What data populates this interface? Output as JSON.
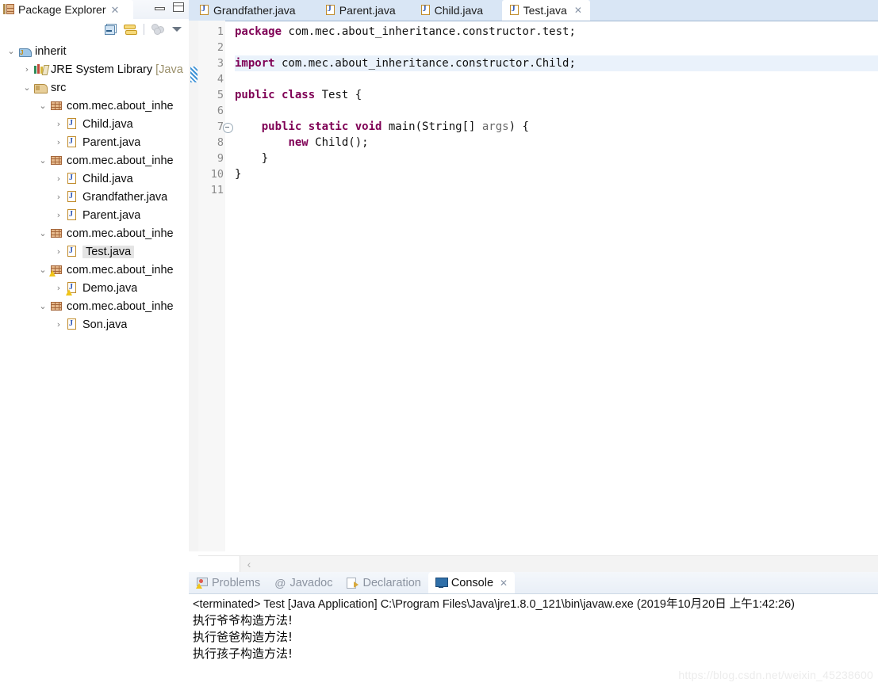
{
  "explorer": {
    "title": "Package Explorer",
    "close_icon": "✕",
    "minimize_tooltip": "Minimize",
    "maximize_tooltip": "Maximize",
    "toolbar": {
      "collapse_all": "collapse-all-icon",
      "link_with_editor": "link-with-editor-icon",
      "hierarchy": "hierarchy-icon",
      "view_menu": "view-menu-icon"
    },
    "tree": [
      {
        "label": "inherit",
        "icon": "java-project-icon",
        "arrow": "⌄",
        "indent": 0,
        "type": "project",
        "selected": false
      },
      {
        "label": "JRE System Library [Java",
        "icon": "jre-library-icon",
        "arrow": "›",
        "indent": 1,
        "type": "library",
        "selected": false
      },
      {
        "label": "src",
        "icon": "source-folder-icon",
        "arrow": "⌄",
        "indent": 1,
        "type": "source-folder",
        "selected": false
      },
      {
        "label": "com.mec.about_inhe",
        "icon": "package-icon",
        "arrow": "⌄",
        "indent": 2,
        "type": "package",
        "selected": false
      },
      {
        "label": "Child.java",
        "icon": "java-file-icon",
        "arrow": "›",
        "indent": 3,
        "type": "file",
        "selected": false
      },
      {
        "label": "Parent.java",
        "icon": "java-file-icon",
        "arrow": "›",
        "indent": 3,
        "type": "file",
        "selected": false
      },
      {
        "label": "com.mec.about_inhe",
        "icon": "package-icon",
        "arrow": "⌄",
        "indent": 2,
        "type": "package",
        "selected": false
      },
      {
        "label": "Child.java",
        "icon": "java-file-icon",
        "arrow": "›",
        "indent": 3,
        "type": "file",
        "selected": false
      },
      {
        "label": "Grandfather.java",
        "icon": "java-file-icon",
        "arrow": "›",
        "indent": 3,
        "type": "file",
        "selected": false
      },
      {
        "label": "Parent.java",
        "icon": "java-file-icon",
        "arrow": "›",
        "indent": 3,
        "type": "file",
        "selected": false
      },
      {
        "label": "com.mec.about_inhe",
        "icon": "package-icon",
        "arrow": "⌄",
        "indent": 2,
        "type": "package",
        "selected": false
      },
      {
        "label": "Test.java",
        "icon": "java-file-icon",
        "arrow": "›",
        "indent": 3,
        "type": "file",
        "selected": true
      },
      {
        "label": "com.mec.about_inhe",
        "icon": "package-warning-icon",
        "arrow": "⌄",
        "indent": 2,
        "type": "package",
        "selected": false,
        "warning": true
      },
      {
        "label": "Demo.java",
        "icon": "java-file-warning-icon",
        "arrow": "›",
        "indent": 3,
        "type": "file",
        "selected": false,
        "warning": true
      },
      {
        "label": "com.mec.about_inhe",
        "icon": "package-icon",
        "arrow": "⌄",
        "indent": 2,
        "type": "package",
        "selected": false
      },
      {
        "label": "Son.java",
        "icon": "java-file-icon",
        "arrow": "›",
        "indent": 3,
        "type": "file",
        "selected": false
      }
    ]
  },
  "editor": {
    "tabs": [
      {
        "label": "Grandfather.java",
        "active": false,
        "closable": false
      },
      {
        "label": "Parent.java",
        "active": false,
        "closable": false
      },
      {
        "label": "Child.java",
        "active": false,
        "closable": false
      },
      {
        "label": "Test.java",
        "active": true,
        "closable": true
      }
    ],
    "close_icon": "✕",
    "scroll_left_arrow": "‹",
    "highlighted_line": 3,
    "fold_marker_line": 7,
    "line_numbers": [
      "1",
      "2",
      "3",
      "4",
      "5",
      "6",
      "7",
      "8",
      "9",
      "10",
      "11"
    ],
    "code_lines": [
      {
        "n": 1,
        "segments": [
          {
            "t": "package",
            "c": "kw"
          },
          {
            "t": " com.mec.about_inheritance.constructor.test;",
            "c": ""
          }
        ]
      },
      {
        "n": 2,
        "segments": [
          {
            "t": "",
            "c": ""
          }
        ]
      },
      {
        "n": 3,
        "segments": [
          {
            "t": "import",
            "c": "kw"
          },
          {
            "t": " com.mec.about_inheritance.constructor.Child;",
            "c": ""
          }
        ]
      },
      {
        "n": 4,
        "segments": [
          {
            "t": "",
            "c": ""
          }
        ]
      },
      {
        "n": 5,
        "segments": [
          {
            "t": "public class",
            "c": "kw"
          },
          {
            "t": " Test {",
            "c": ""
          }
        ]
      },
      {
        "n": 6,
        "segments": [
          {
            "t": "",
            "c": ""
          }
        ]
      },
      {
        "n": 7,
        "segments": [
          {
            "t": "    ",
            "c": ""
          },
          {
            "t": "public static void",
            "c": "kw"
          },
          {
            "t": " main(String[] ",
            "c": ""
          },
          {
            "t": "args",
            "c": "param"
          },
          {
            "t": ") {",
            "c": ""
          }
        ]
      },
      {
        "n": 8,
        "segments": [
          {
            "t": "        ",
            "c": ""
          },
          {
            "t": "new",
            "c": "kw"
          },
          {
            "t": " Child();",
            "c": ""
          }
        ]
      },
      {
        "n": 9,
        "segments": [
          {
            "t": "    }",
            "c": ""
          }
        ]
      },
      {
        "n": 10,
        "segments": [
          {
            "t": "}",
            "c": ""
          }
        ]
      },
      {
        "n": 11,
        "segments": [
          {
            "t": "",
            "c": ""
          }
        ]
      }
    ]
  },
  "bottom_panel": {
    "tabs": [
      {
        "label": "Problems",
        "icon": "problems-icon",
        "active": false
      },
      {
        "label": "Javadoc",
        "icon": "javadoc-at-icon",
        "active": false
      },
      {
        "label": "Declaration",
        "icon": "declaration-icon",
        "active": false
      },
      {
        "label": "Console",
        "icon": "console-icon",
        "active": true
      }
    ],
    "close_icon": "✕",
    "console": {
      "header": "<terminated> Test [Java Application] C:\\Program Files\\Java\\jre1.8.0_121\\bin\\javaw.exe (2019年10月20日 上午1:42:26)",
      "output_lines": [
        "执行爷爷构造方法!",
        "执行爸爸构造方法!",
        "执行孩子构造方法!"
      ]
    }
  },
  "watermark": "https://blog.csdn.net/weixin_45238600",
  "colors": {
    "tab_strip_bg": "#d9e6f5",
    "active_tab_bg": "#ffffff",
    "keyword": "#7f0055",
    "parameter": "#6a6a6a",
    "current_line_highlight": "#eaf2fb",
    "selection": "#e4e4e4"
  }
}
